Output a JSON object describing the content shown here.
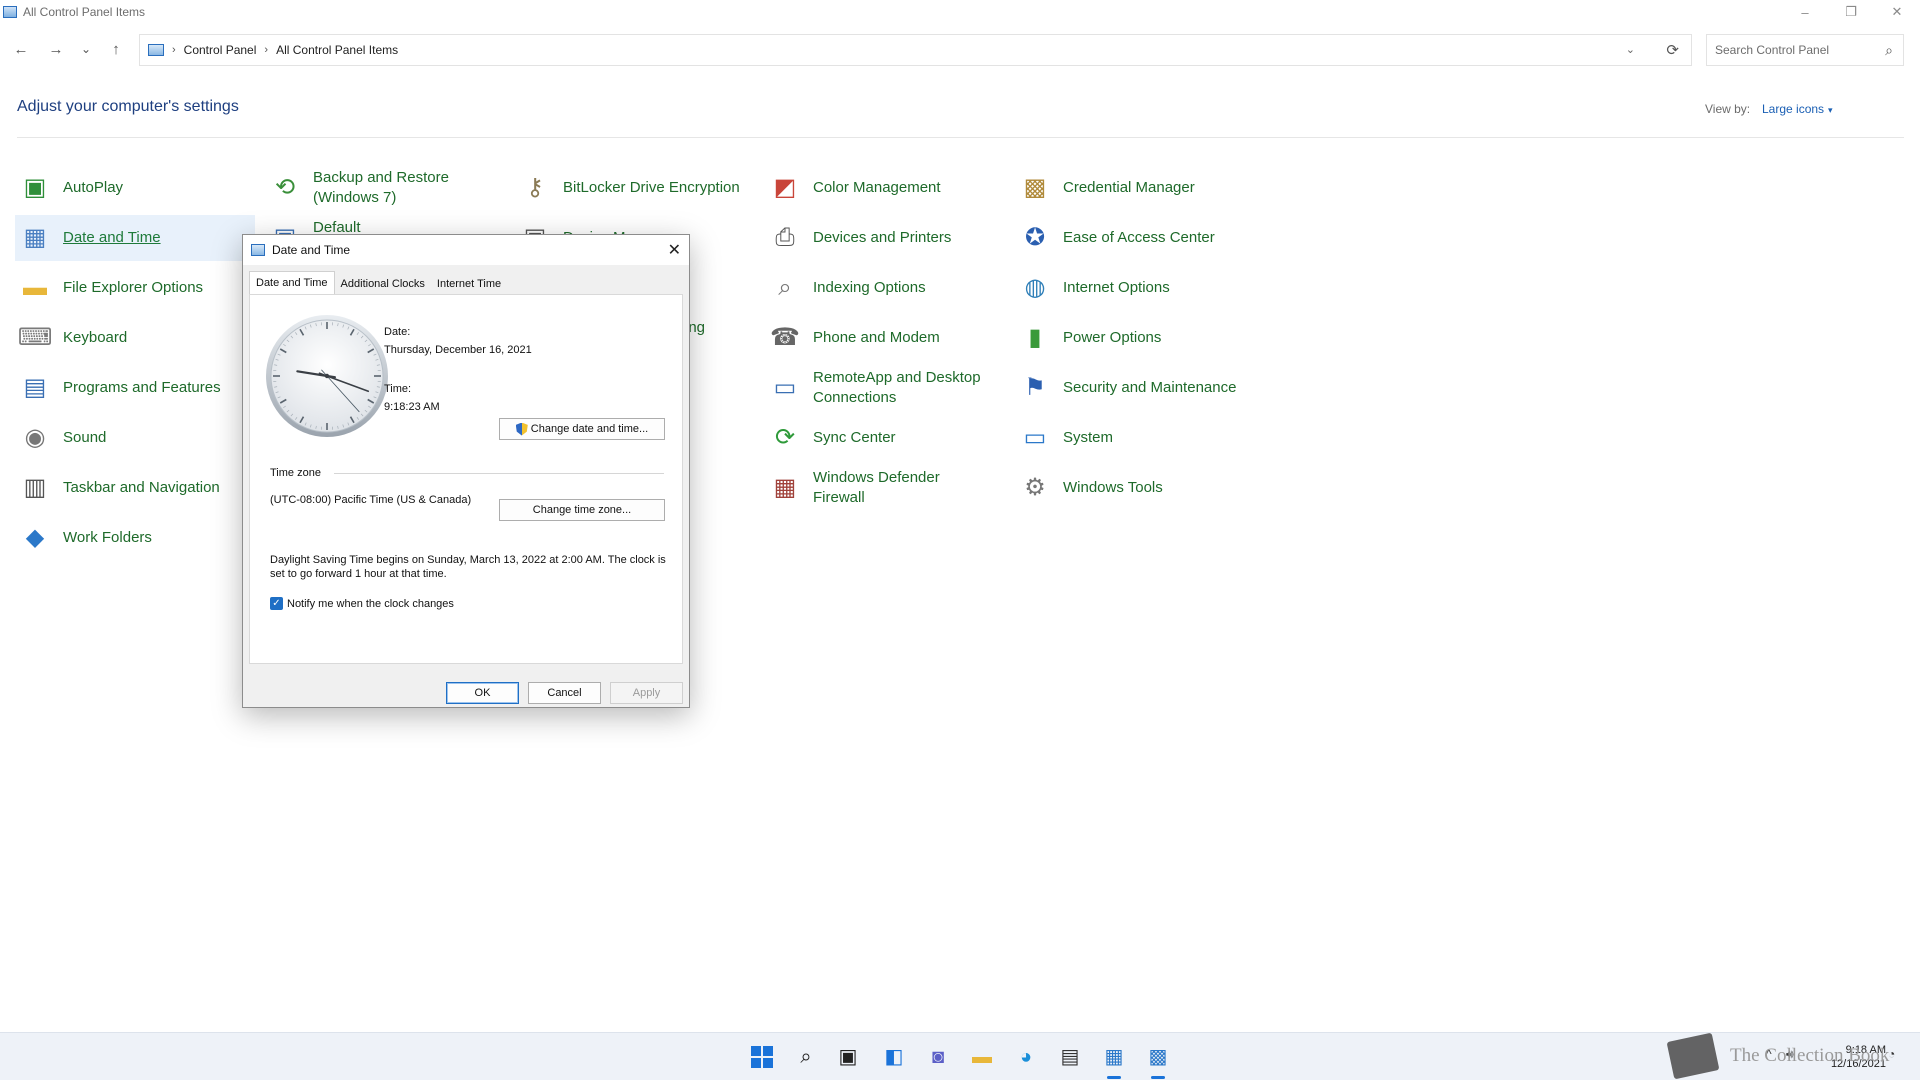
{
  "window": {
    "title": "All Control Panel Items",
    "controls": {
      "minimize": "–",
      "restore": "❐",
      "close": "✕"
    }
  },
  "nav": {
    "back_icon": "←",
    "forward_icon": "→",
    "history_icon": "⌄",
    "up_icon": "↑",
    "breadcrumb": [
      "Control Panel",
      "All Control Panel Items"
    ],
    "dropdown_icon": "⌄",
    "refresh_icon": "⟳",
    "search_placeholder": "Search Control Panel",
    "search_icon": "⌕"
  },
  "header": {
    "title": "Adjust your computer's settings",
    "view_by_label": "View by:",
    "view_by_value": "Large icons",
    "view_by_caret": "▾"
  },
  "items": {
    "autoplay": "AutoPlay",
    "backup_restore": "Backup and Restore (Windows 7)",
    "bitlocker": "BitLocker Drive Encryption",
    "color_mgmt": "Color Management",
    "credential": "Credential Manager",
    "date_time": "Date and Time",
    "devices_printers": "Devices and Printers",
    "ease_access": "Ease of Access Center",
    "file_explorer": "File Explorer Options",
    "indexing": "Indexing Options",
    "internet_options": "Internet Options",
    "keyboard": "Keyboard",
    "phone_modem": "Phone and Modem",
    "power_options": "Power Options",
    "programs_features": "Programs and Features",
    "remoteapp": "RemoteApp and Desktop Connections",
    "security_maint": "Security and Maintenance",
    "sound": "Sound",
    "sync_center": "Sync Center",
    "system": "System",
    "taskbar_nav": "Taskbar and Navigation",
    "defender_fw": "Windows Defender Firewall",
    "win_tools": "Windows Tools",
    "work_folders": "Work Folders",
    "partial_default": "Default P",
    "partial_device": "Device M",
    "partial_ing": "ing"
  },
  "dialog": {
    "title": "Date and Time",
    "close_icon": "✕",
    "tabs": [
      "Date and Time",
      "Additional Clocks",
      "Internet Time"
    ],
    "date_label": "Date:",
    "date_value": "Thursday, December 16, 2021",
    "time_label": "Time:",
    "time_value": "9:18:23 AM",
    "change_datetime_btn": "Change date and time...",
    "timezone_label": "Time zone",
    "timezone_value": "(UTC-08:00) Pacific Time (US & Canada)",
    "change_tz_btn": "Change time zone...",
    "dst_text": "Daylight Saving Time begins on Sunday, March 13, 2022 at 2:00 AM. The clock is set to go forward 1 hour at that time.",
    "notify_label": "Notify me when the clock changes",
    "notify_checked": true,
    "ok": "OK",
    "cancel": "Cancel",
    "apply": "Apply",
    "clock_hands": {
      "hour": 9,
      "minute": 18,
      "second": 23
    }
  },
  "taskbar": {
    "clock_time": "9:18 AM",
    "clock_date": "12/16/2021",
    "tray_caret": "^",
    "watermark": "The Collection Book"
  },
  "colors": {
    "accent": "#1a73d9",
    "link_green": "#1e6a2a",
    "heading_blue": "#1e3f80",
    "selection": "#e8f1fb"
  }
}
